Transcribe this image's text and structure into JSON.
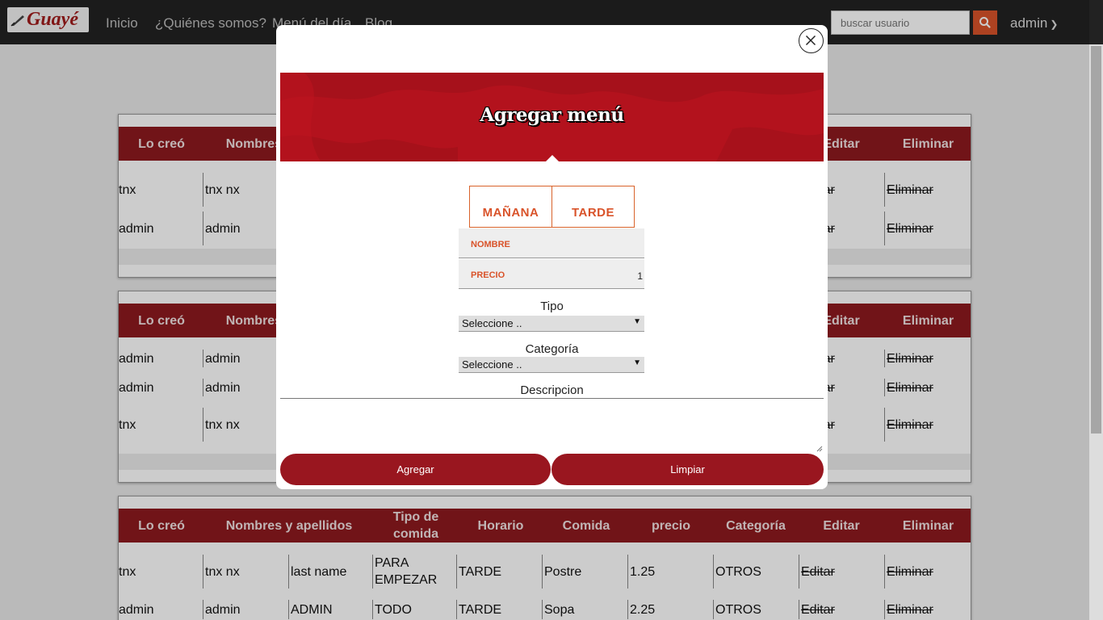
{
  "navbar": {
    "logo_text": "Guayé",
    "links": [
      "Inicio",
      "¿Quiénes somos?",
      "Menú del día",
      "Blog"
    ],
    "search_placeholder": "buscar usuario",
    "user": "admin"
  },
  "table_headers": [
    "Lo creó",
    "Nombres y apellidos",
    "Tipo de comida",
    "Horario",
    "Comida",
    "precio",
    "Categoría",
    "Editar",
    "Eliminar"
  ],
  "tables": [
    {
      "rows": [
        [
          "tnx",
          "tnx nx",
          "",
          "",
          "",
          "",
          "",
          "Editar",
          "Eliminar"
        ],
        [
          "admin",
          "admin",
          "",
          "",
          "",
          "",
          "",
          "Editar",
          "Eliminar"
        ]
      ]
    },
    {
      "rows": [
        [
          "admin",
          "admin",
          "",
          "",
          "",
          "",
          "",
          "Editar",
          "Eliminar"
        ],
        [
          "admin",
          "admin",
          "",
          "",
          "",
          "",
          "",
          "Editar",
          "Eliminar"
        ],
        [
          "tnx",
          "tnx nx",
          "",
          "",
          "",
          "",
          "",
          "Editar",
          "Eliminar"
        ]
      ]
    },
    {
      "rows": [
        [
          "tnx",
          "tnx nx",
          "last name",
          "PARA EMPEZAR",
          "TARDE",
          "Postre",
          "1.25",
          "OTROS",
          "Editar",
          "Eliminar"
        ],
        [
          "admin",
          "admin",
          "ADMIN",
          "TODO",
          "TARDE",
          "Sopa",
          "2.25",
          "OTROS",
          "Editar",
          "Eliminar"
        ]
      ]
    }
  ],
  "modal": {
    "title": "Agregar menú",
    "tabs": [
      "MAÑANA",
      "TARDE"
    ],
    "fields": {
      "nombre_label": "NOMBRE",
      "nombre_value": "",
      "precio_label": "PRECIO",
      "precio_value": "1"
    },
    "tipo_label": "Tipo",
    "tipo_selected": "Seleccione ..",
    "categoria_label": "Categoría",
    "categoria_selected": "Seleccione ..",
    "descripcion_label": "Descripcion",
    "descripcion_value": "",
    "add_button": "Agregar",
    "clear_button": "Limpiar"
  },
  "colors": {
    "navbar": "#222222",
    "table_header": "#8e1a1f",
    "accent": "#d9532a",
    "banner": "#b3121d",
    "button": "#99161f"
  }
}
